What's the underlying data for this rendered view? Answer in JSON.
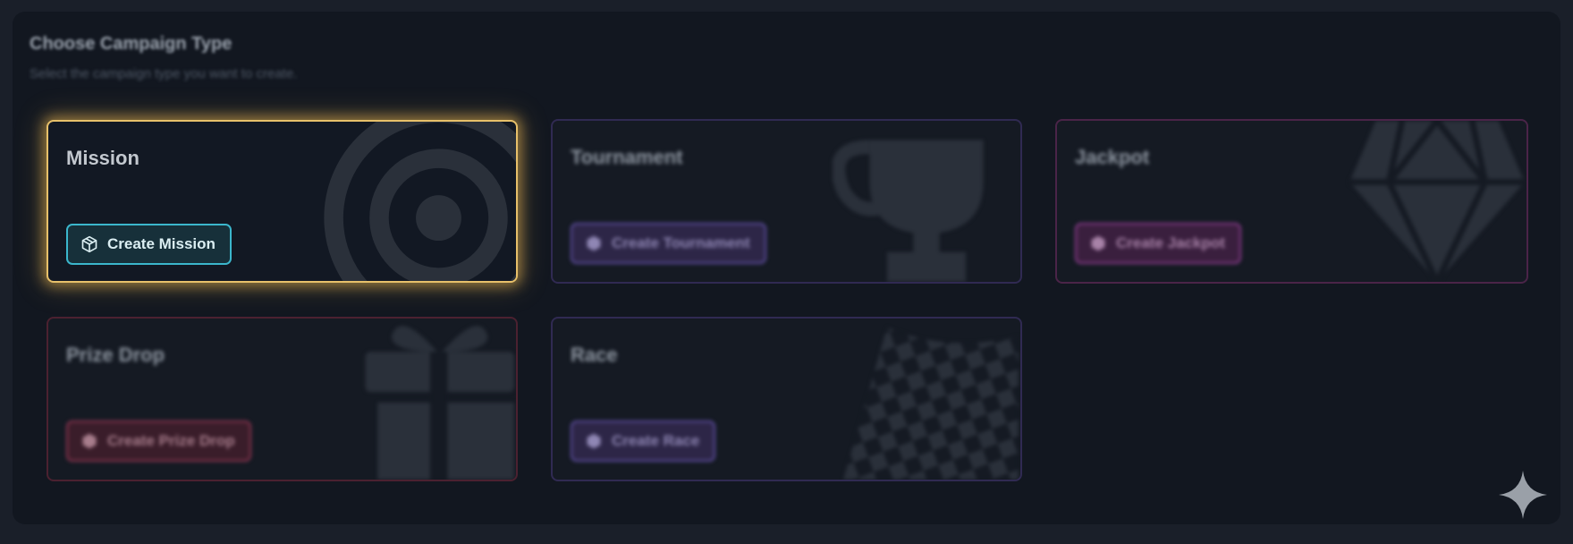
{
  "section": {
    "title": "Choose Campaign Type",
    "subtitle": "Select the campaign type you want to create."
  },
  "cards": [
    {
      "title": "Mission",
      "button": "Create Mission",
      "icon": "target-icon",
      "button_icon": "cube-icon",
      "selected": true,
      "accent": "#3bb6cc"
    },
    {
      "title": "Tournament",
      "button": "Create Tournament",
      "icon": "trophy-icon",
      "button_icon": "cube-icon",
      "selected": false,
      "accent": "#5e4ea0"
    },
    {
      "title": "Jackpot",
      "button": "Create Jackpot",
      "icon": "diamond-icon",
      "button_icon": "cube-icon",
      "selected": false,
      "accent": "#8a3c8c"
    },
    {
      "title": "Prize Drop",
      "button": "Create Prize Drop",
      "icon": "gift-icon",
      "button_icon": "cube-icon",
      "selected": false,
      "accent": "#8c3550"
    },
    {
      "title": "Race",
      "button": "Create Race",
      "icon": "checkered-flag-icon",
      "button_icon": "cube-icon",
      "selected": false,
      "accent": "#5e4ea0"
    }
  ],
  "colors": {
    "selected_border": "#e7c06a",
    "panel_bg": "#121720",
    "page_bg": "#1a1f29"
  },
  "overlay_icon": "sparkle-icon"
}
